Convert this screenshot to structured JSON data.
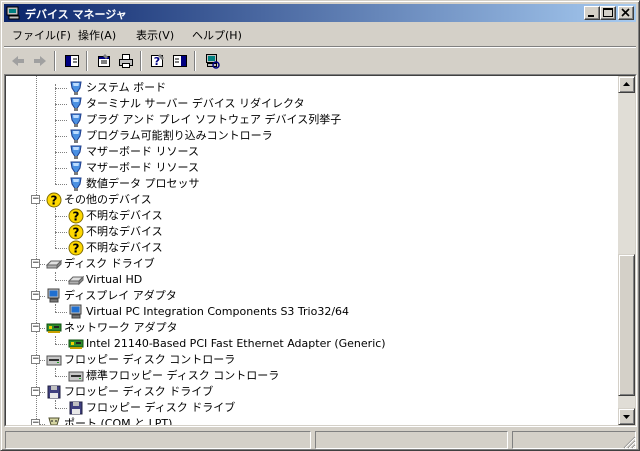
{
  "window": {
    "title": "デバイス マネージャ"
  },
  "menu": [
    "ファイル(F)",
    "操作(A)",
    "表示(V)",
    "ヘルプ(H)"
  ],
  "tree": [
    {
      "label": "システム ボード",
      "icon": "device-icon",
      "level": 2
    },
    {
      "label": "ターミナル サーバー デバイス リダイレクタ",
      "icon": "device-icon",
      "level": 2
    },
    {
      "label": "プラグ アンド プレイ ソフトウェア デバイス列挙子",
      "icon": "device-icon",
      "level": 2
    },
    {
      "label": "プログラム可能割り込みコントローラ",
      "icon": "device-icon",
      "level": 2
    },
    {
      "label": "マザーボード リソース",
      "icon": "device-icon",
      "level": 2
    },
    {
      "label": "マザーボード リソース",
      "icon": "device-icon",
      "level": 2
    },
    {
      "label": "数値データ プロセッサ",
      "icon": "device-icon",
      "level": 2
    },
    {
      "label": "その他のデバイス",
      "icon": "unknown-device-icon",
      "level": 1,
      "expander": "−"
    },
    {
      "label": "不明なデバイス",
      "icon": "unknown-device-icon",
      "level": 2
    },
    {
      "label": "不明なデバイス",
      "icon": "unknown-device-icon",
      "level": 2
    },
    {
      "label": "不明なデバイス",
      "icon": "unknown-device-icon",
      "level": 2
    },
    {
      "label": "ディスク ドライブ",
      "icon": "disk-drive-icon",
      "level": 1,
      "expander": "−"
    },
    {
      "label": "Virtual HD",
      "icon": "disk-drive-icon",
      "level": 2
    },
    {
      "label": "ディスプレイ アダプタ",
      "icon": "display-adapter-icon",
      "level": 1,
      "expander": "−"
    },
    {
      "label": "Virtual PC Integration Components S3 Trio32/64",
      "icon": "display-adapter-icon",
      "level": 2
    },
    {
      "label": "ネットワーク アダプタ",
      "icon": "network-adapter-icon",
      "level": 1,
      "expander": "−"
    },
    {
      "label": "Intel 21140-Based PCI Fast Ethernet Adapter (Generic)",
      "icon": "network-adapter-icon",
      "level": 2
    },
    {
      "label": "フロッピー ディスク コントローラ",
      "icon": "floppy-controller-icon",
      "level": 1,
      "expander": "−"
    },
    {
      "label": "標準フロッピー ディスク コントローラ",
      "icon": "floppy-controller-icon",
      "level": 2
    },
    {
      "label": "フロッピー ディスク ドライブ",
      "icon": "floppy-drive-icon",
      "level": 1,
      "expander": "−"
    },
    {
      "label": "フロッピー ディスク ドライブ",
      "icon": "floppy-drive-icon",
      "level": 2
    },
    {
      "label": "ポート (COM と LPT)",
      "icon": "port-icon",
      "level": 1,
      "expander": "−"
    }
  ],
  "scrollbar": {
    "position_fraction": 0.93,
    "visible_fraction": 0.45
  }
}
